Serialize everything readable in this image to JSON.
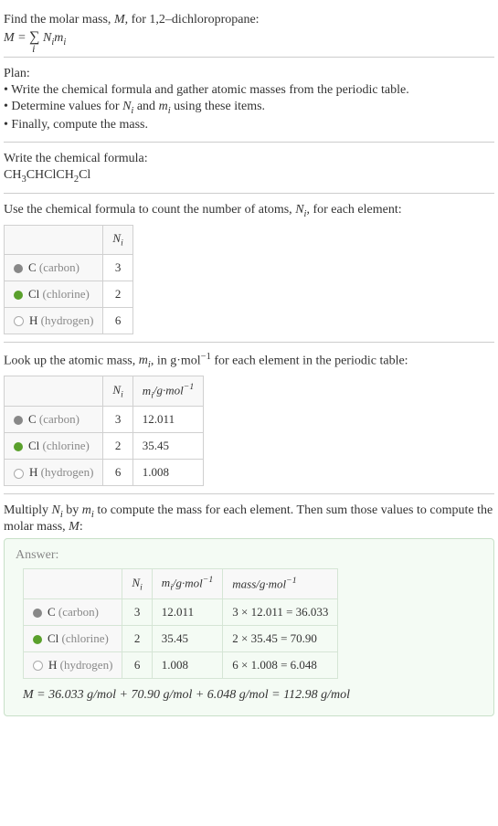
{
  "intro": {
    "line1_prefix": "Find the molar mass, ",
    "line1_var": "M",
    "line1_suffix": ", for 1,2–dichloropropane:",
    "eq_lhs": "M",
    "eq_rhs_sum": "N",
    "eq_rhs_sum2": "m",
    "eq_sub": "i"
  },
  "plan": {
    "heading": "Plan:",
    "b1": "• Write the chemical formula and gather atomic masses from the periodic table.",
    "b2_pre": "• Determine values for ",
    "b2_mid": " and ",
    "b2_post": " using these items.",
    "b3": "• Finally, compute the mass."
  },
  "formula": {
    "heading": "Write the chemical formula:",
    "chem_parts": [
      "CH",
      "3",
      "CHClCH",
      "2",
      "Cl"
    ]
  },
  "count": {
    "heading_pre": "Use the chemical formula to count the number of atoms, ",
    "heading_post": ", for each element:",
    "col_Ni": "N",
    "elements": [
      {
        "dot": "dot-c",
        "sym": "C",
        "name": "(carbon)",
        "N": "3"
      },
      {
        "dot": "dot-cl",
        "sym": "Cl",
        "name": "(chlorine)",
        "N": "2"
      },
      {
        "dot": "dot-h",
        "sym": "H",
        "name": "(hydrogen)",
        "N": "6"
      }
    ]
  },
  "lookup": {
    "heading_pre": "Look up the atomic mass, ",
    "heading_mid": ", in g·mol",
    "heading_post": " for each element in the periodic table:",
    "col_mi_pre": "m",
    "col_mi_unit": "/g·mol",
    "elements": [
      {
        "dot": "dot-c",
        "sym": "C",
        "name": "(carbon)",
        "N": "3",
        "m": "12.011"
      },
      {
        "dot": "dot-cl",
        "sym": "Cl",
        "name": "(chlorine)",
        "N": "2",
        "m": "35.45"
      },
      {
        "dot": "dot-h",
        "sym": "H",
        "name": "(hydrogen)",
        "N": "6",
        "m": "1.008"
      }
    ]
  },
  "multiply": {
    "heading_pre": "Multiply ",
    "heading_mid": " by ",
    "heading_mid2": " to compute the mass for each element. Then sum those values to compute the molar mass, ",
    "heading_post": ":",
    "answer_label": "Answer:",
    "col_mass": "mass/g·mol",
    "elements": [
      {
        "dot": "dot-c",
        "sym": "C",
        "name": "(carbon)",
        "N": "3",
        "m": "12.011",
        "mass": "3 × 12.011 = 36.033"
      },
      {
        "dot": "dot-cl",
        "sym": "Cl",
        "name": "(chlorine)",
        "N": "2",
        "m": "35.45",
        "mass": "2 × 35.45 = 70.90"
      },
      {
        "dot": "dot-h",
        "sym": "H",
        "name": "(hydrogen)",
        "N": "6",
        "m": "1.008",
        "mass": "6 × 1.008 = 6.048"
      }
    ],
    "result_eq": "M = 36.033 g/mol + 70.90 g/mol + 6.048 g/mol = 112.98 g/mol"
  },
  "chart_data": {
    "type": "table",
    "title": "Molar mass of 1,2-dichloropropane",
    "elements": [
      {
        "element": "C (carbon)",
        "N_i": 3,
        "m_i_g_per_mol": 12.011,
        "mass_g_per_mol": 36.033
      },
      {
        "element": "Cl (chlorine)",
        "N_i": 2,
        "m_i_g_per_mol": 35.45,
        "mass_g_per_mol": 70.9
      },
      {
        "element": "H (hydrogen)",
        "N_i": 6,
        "m_i_g_per_mol": 1.008,
        "mass_g_per_mol": 6.048
      }
    ],
    "molar_mass_g_per_mol": 112.98
  }
}
